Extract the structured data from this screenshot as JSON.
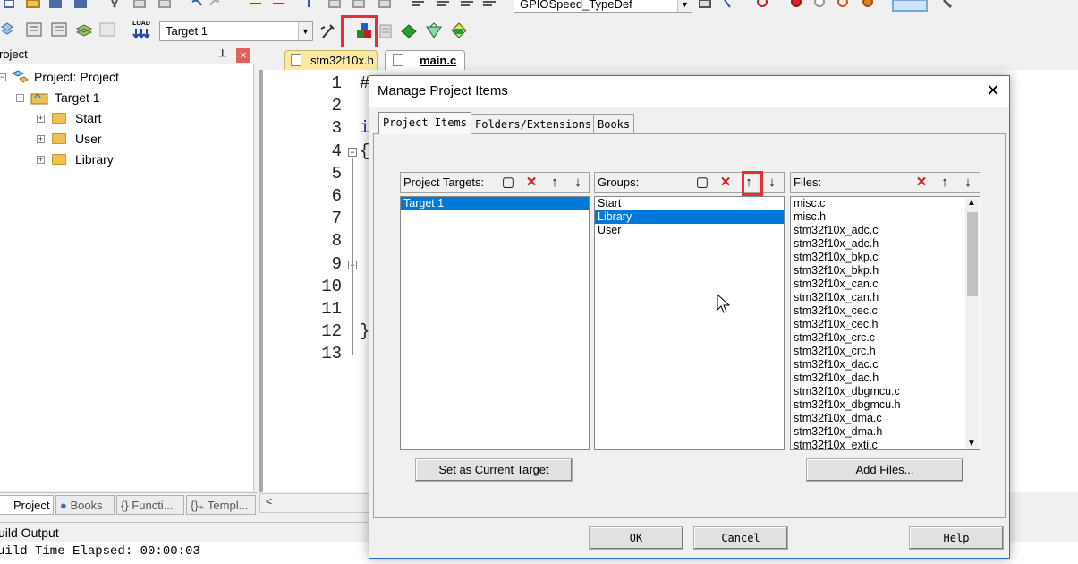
{
  "toolbar_top": {
    "config_combo": "GPIOSpeed_TypeDef"
  },
  "toolbar": {
    "target_combo": "Target 1",
    "load_label": "LOAD"
  },
  "project_panel": {
    "title": "roject",
    "pin": "⊥",
    "close": "×",
    "tree": {
      "root": "Project: Project",
      "target": "Target 1",
      "groups": [
        "Start",
        "User",
        "Library"
      ]
    },
    "tabs": [
      "Project",
      "Books",
      "{} Functi...",
      "{}₊ Templ..."
    ]
  },
  "editor": {
    "tabs": [
      "stm32f10x.h",
      "main.c"
    ],
    "line_numbers": [
      "1",
      "2",
      "3",
      "4",
      "5",
      "6",
      "7",
      "8",
      "9",
      "10",
      "11",
      "12",
      "13"
    ],
    "code_fragments": {
      "line1": "#",
      "line3": "i",
      "line4": "{",
      "line12": "}"
    }
  },
  "build_output": {
    "title": "uild Output",
    "line": "uild Time Elapsed:  00:00:03"
  },
  "dialog": {
    "title": "Manage Project Items",
    "close": "✕",
    "tabs": [
      "Project Items",
      "Folders/Extensions",
      "Books"
    ],
    "targets": {
      "label": "Project Targets:",
      "items": [
        "Target 1"
      ],
      "selected": 0
    },
    "groups": {
      "label": "Groups:",
      "items": [
        "Start",
        "Library",
        "User"
      ],
      "selected": 1
    },
    "files": {
      "label": "Files:",
      "items": [
        "misc.c",
        "misc.h",
        "stm32f10x_adc.c",
        "stm32f10x_adc.h",
        "stm32f10x_bkp.c",
        "stm32f10x_bkp.h",
        "stm32f10x_can.c",
        "stm32f10x_can.h",
        "stm32f10x_cec.c",
        "stm32f10x_cec.h",
        "stm32f10x_crc.c",
        "stm32f10x_crc.h",
        "stm32f10x_dac.c",
        "stm32f10x_dac.h",
        "stm32f10x_dbgmcu.c",
        "stm32f10x_dbgmcu.h",
        "stm32f10x_dma.c",
        "stm32f10x_dma.h",
        "stm32f10x_exti.c"
      ]
    },
    "buttons": {
      "set_current": "Set as Current Target",
      "add_files": "Add Files...",
      "ok": "OK",
      "cancel": "Cancel",
      "help": "Help"
    }
  },
  "colors": {
    "selection": "#0078d7",
    "highlight": "#e0303a",
    "tab_yellow": "#fae9a6"
  }
}
